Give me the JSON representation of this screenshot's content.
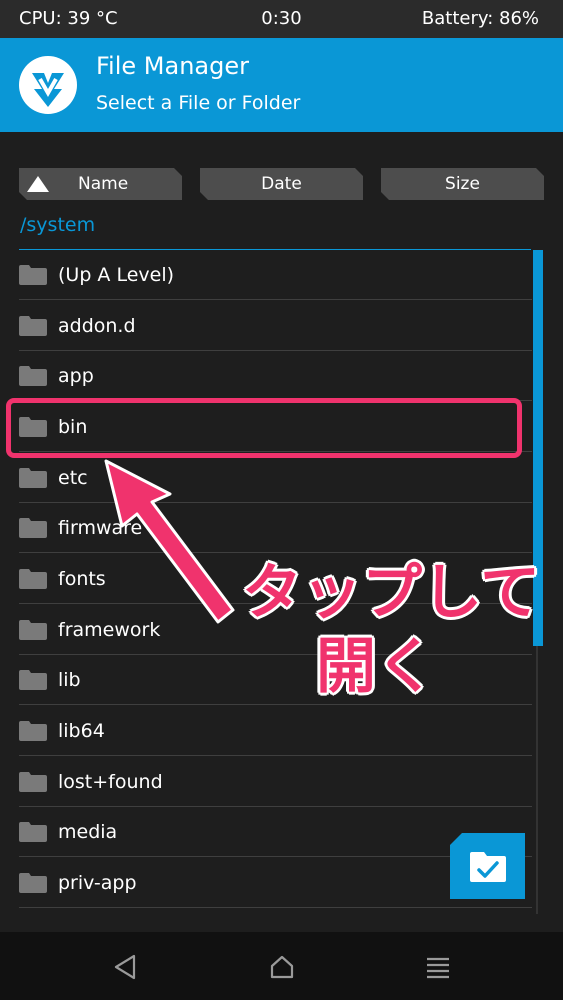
{
  "status_bar": {
    "cpu": "CPU: 39 °C",
    "time": "0:30",
    "battery": "Battery: 86%"
  },
  "header": {
    "title": "File Manager",
    "subtitle": "Select a File or Folder"
  },
  "sort": {
    "name_label": "Name",
    "date_label": "Date",
    "size_label": "Size"
  },
  "path": "/system",
  "files": [
    {
      "name": "(Up A Level)"
    },
    {
      "name": "addon.d"
    },
    {
      "name": "app"
    },
    {
      "name": "bin"
    },
    {
      "name": "etc"
    },
    {
      "name": "firmware"
    },
    {
      "name": "fonts"
    },
    {
      "name": "framework"
    },
    {
      "name": "lib"
    },
    {
      "name": "lib64"
    },
    {
      "name": "lost+found"
    },
    {
      "name": "media"
    },
    {
      "name": "priv-app"
    }
  ],
  "annotation": {
    "line1": "タップして",
    "line2": "開く"
  },
  "icons": {
    "logo": "twrp-logo-icon",
    "folder": "folder-icon",
    "sort": "triangle-up-icon",
    "fab": "folder-check-icon",
    "nav": [
      "back-icon",
      "home-icon",
      "menu-icon"
    ]
  },
  "colors": {
    "accent": "#0a97d6",
    "background": "#1e1e1e",
    "highlight": "#f0336d"
  }
}
